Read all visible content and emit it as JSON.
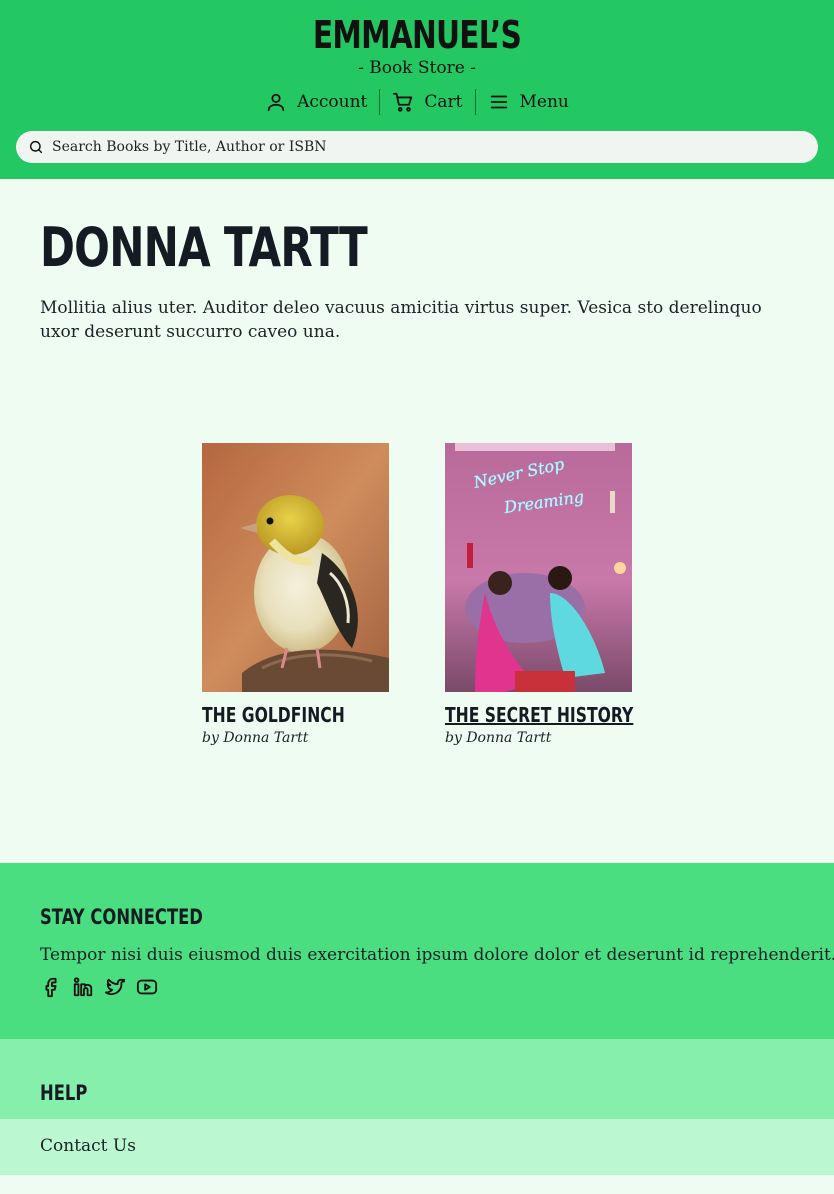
{
  "header": {
    "brand_name": "EMMANUEL’S",
    "brand_sub": "- Book Store -",
    "nav": {
      "account": "Account",
      "cart": "Cart",
      "menu": "Menu"
    },
    "search": {
      "placeholder": "Search Books by Title, Author or ISBN"
    }
  },
  "main": {
    "author": "DONNA TARTT",
    "description": "Mollitia alius uter. Auditor deleo vacuus amicitia virtus super. Vesica sto derelinquo uxor deserunt succurro caveo una.",
    "books": [
      {
        "title": "THE GOLDFINCH",
        "byline": "by Donna Tartt",
        "cover": "goldfinch-bird-photo"
      },
      {
        "title": "THE SECRET HISTORY",
        "byline": "by Donna Tartt",
        "cover": "party-neon-sign-photo",
        "neon_text": "Never Stop Dreaming"
      }
    ]
  },
  "footer": {
    "connected_heading": "STAY CONNECTED",
    "connected_text": "Tempor nisi duis eiusmod duis exercitation ipsum dolore dolor et deserunt id reprehenderit.",
    "socials": [
      "facebook-icon",
      "linkedin-icon",
      "twitter-icon",
      "youtube-icon"
    ],
    "help_heading": "HELP",
    "contact_label": "Contact Us"
  },
  "colors": {
    "header_bg": "#23c862",
    "page_bg": "#effcf2",
    "connected_bg": "#4ade80",
    "help_bg": "#86efac",
    "contact_bg": "#bbf7d0"
  }
}
